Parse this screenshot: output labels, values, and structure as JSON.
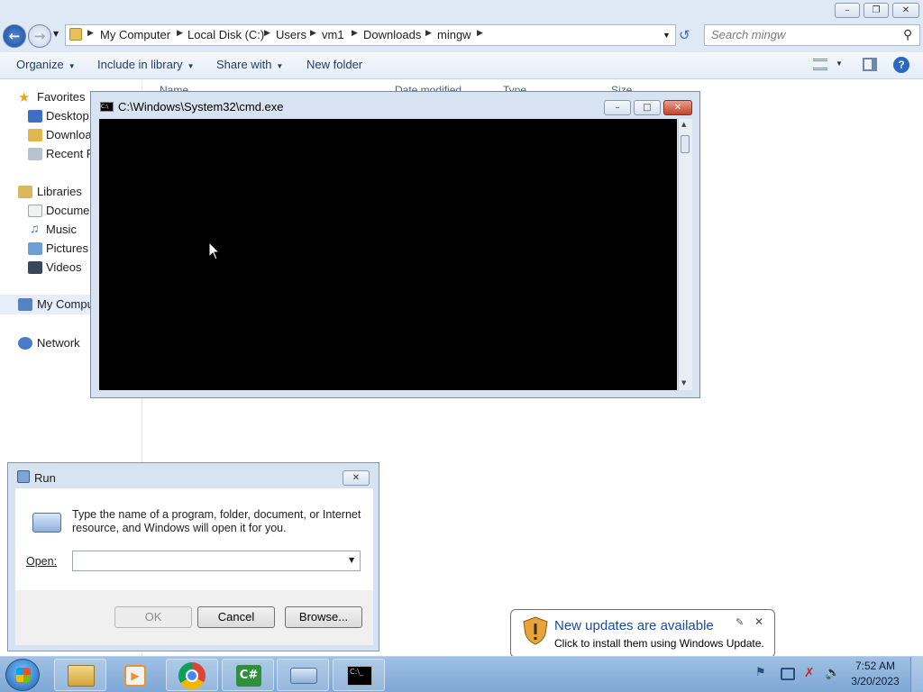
{
  "explorer": {
    "breadcrumb": [
      "My Computer",
      "Local Disk (C:)",
      "Users",
      "vm1",
      "Downloads",
      "mingw"
    ],
    "search_placeholder": "Search mingw",
    "toolbar": {
      "organize": "Organize",
      "include_in_library": "Include in library",
      "share_with": "Share with",
      "new_folder": "New folder"
    },
    "nav": {
      "favorites": "Favorites",
      "desktop": "Desktop",
      "downloads": "Downloads",
      "recent_places": "Recent Places",
      "libraries": "Libraries",
      "documents": "Documents",
      "music": "Music",
      "pictures": "Pictures",
      "videos": "Videos",
      "my_computer": "My Computer",
      "network": "Network"
    },
    "columns": [
      "Name",
      "Date modified",
      "Type",
      "Size"
    ]
  },
  "cmd": {
    "title": "C:\\Windows\\System32\\cmd.exe"
  },
  "run": {
    "title": "Run",
    "description_line1": "Type the name of a program, folder, document, or Internet",
    "description_line2": "resource, and Windows will open it for you.",
    "open_label": "Open:",
    "open_value": "",
    "ok": "OK",
    "cancel": "Cancel",
    "browse": "Browse..."
  },
  "notification": {
    "title": "New updates are available",
    "body": "Click to install them using Windows Update."
  },
  "taskbar": {
    "time": "7:52 AM",
    "date": "3/20/2023",
    "apps": [
      "start-orb",
      "windows-explorer",
      "media-player",
      "chrome",
      "csharp-editor",
      "run-dialog",
      "cmd"
    ]
  },
  "colors": {
    "taskbar": "#8fb4dc",
    "window_frame": "#d8e3f1",
    "console_bg": "#000000",
    "notification_title": "#1a4d9c"
  }
}
